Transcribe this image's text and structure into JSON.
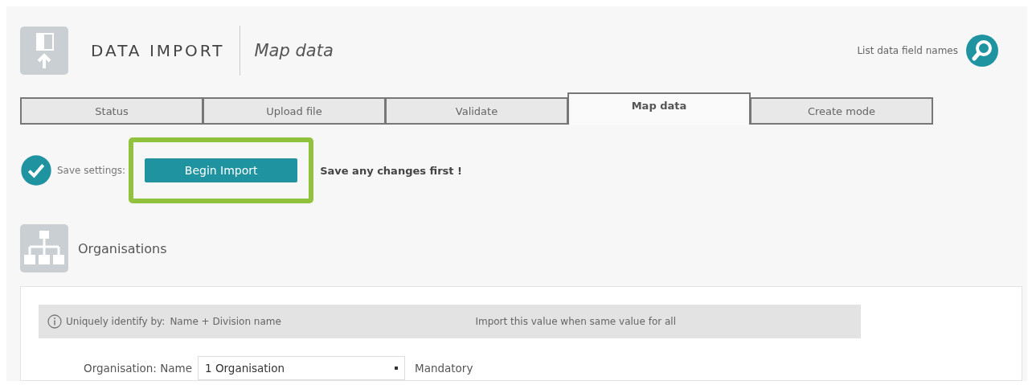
{
  "header": {
    "title": "DATA IMPORT",
    "subtitle": "Map data",
    "link": "List data field names"
  },
  "tabs": [
    {
      "label": "Status",
      "selected": false
    },
    {
      "label": "Upload file",
      "selected": false
    },
    {
      "label": "Validate",
      "selected": false
    },
    {
      "label": "Map data",
      "selected": true
    },
    {
      "label": "Create mode",
      "selected": false
    }
  ],
  "actions": {
    "save_label": "Save settings:",
    "button": "Begin Import",
    "highlighted": true,
    "note": "Save any changes first !"
  },
  "section": {
    "title": "Organisations",
    "info": {
      "label": "Uniquely identify by:",
      "value": "Name + Division name",
      "column_2": "Import this value when same value for all"
    },
    "fields": [
      {
        "label": "Organisation: Name",
        "value": "1 Organisation",
        "note": "Mandatory"
      }
    ]
  }
}
